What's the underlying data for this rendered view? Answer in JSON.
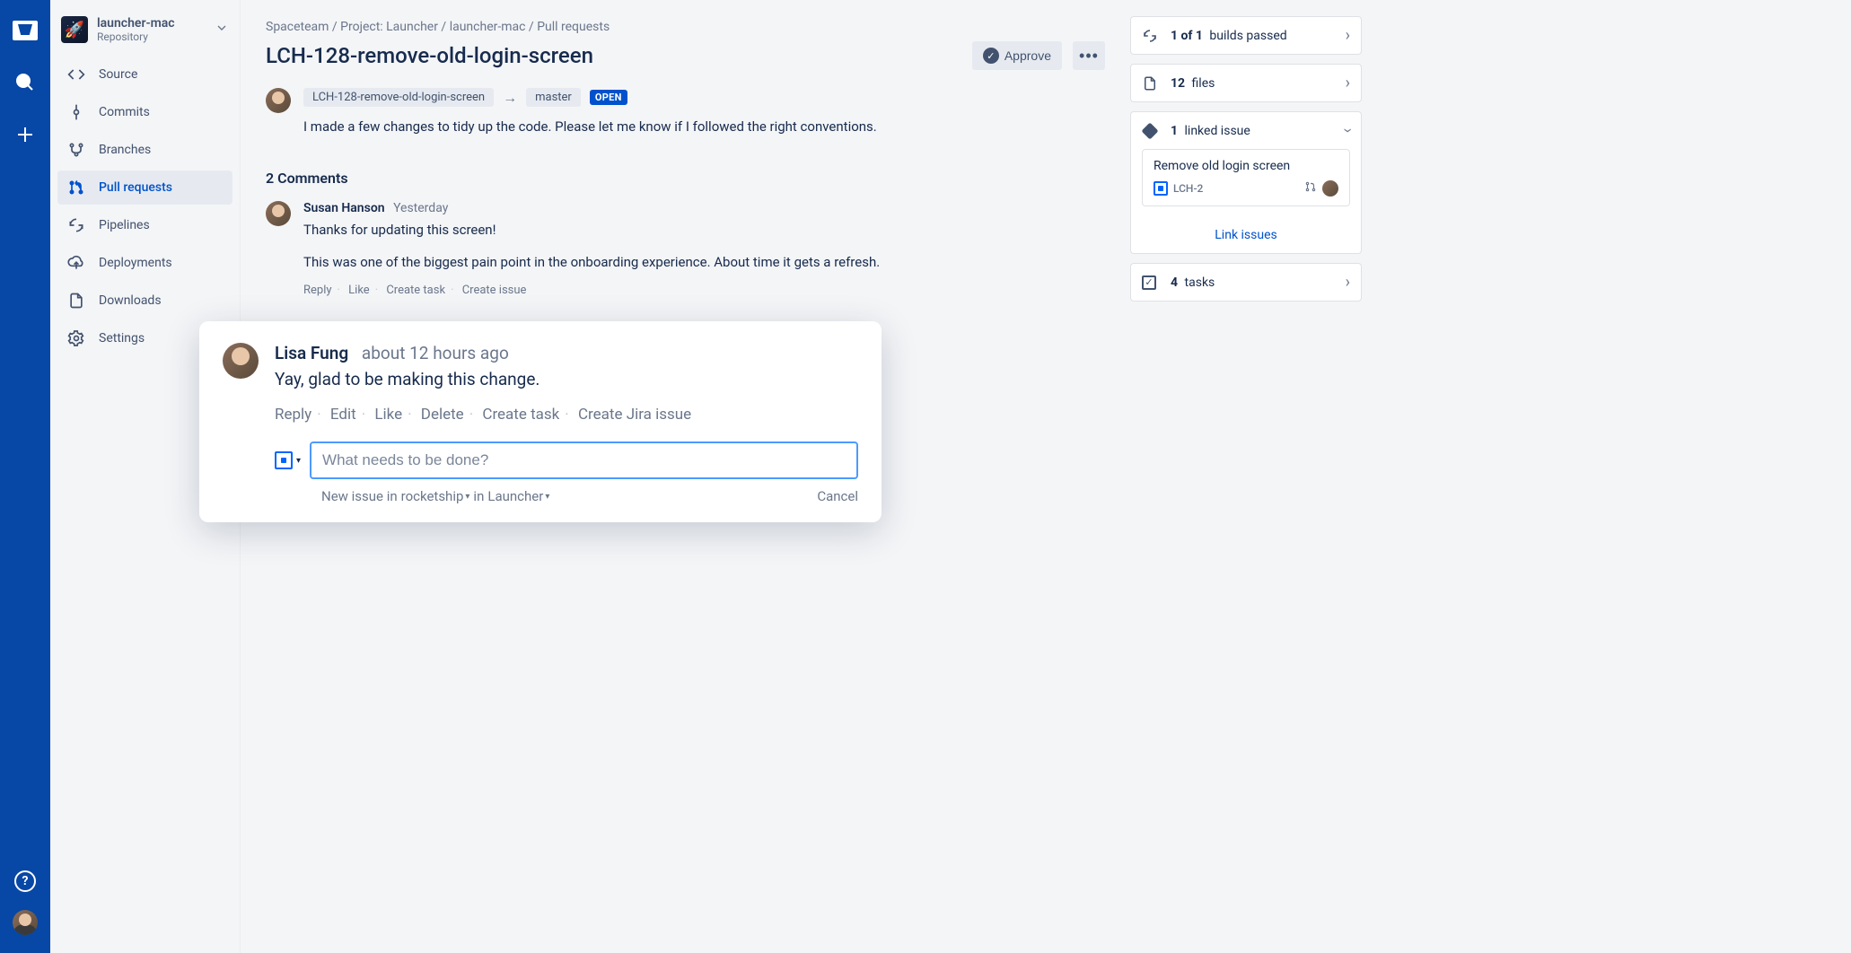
{
  "project": {
    "name": "launcher-mac",
    "type": "Repository"
  },
  "nav": {
    "items": [
      {
        "label": "Source"
      },
      {
        "label": "Commits"
      },
      {
        "label": "Branches"
      },
      {
        "label": "Pull requests"
      },
      {
        "label": "Pipelines"
      },
      {
        "label": "Deployments"
      },
      {
        "label": "Downloads"
      },
      {
        "label": "Settings"
      }
    ]
  },
  "breadcrumb": {
    "a": "Spaceteam",
    "b": "Project: Launcher",
    "c": "launcher-mac",
    "d": "Pull requests"
  },
  "pr": {
    "title": "LCH-128-remove-old-login-screen",
    "approve": "Approve",
    "source_branch": "LCH-128-remove-old-login-screen",
    "target_branch": "master",
    "status": "OPEN",
    "desc": "I made a few changes to tidy up the code. Please let me know if I followed the right conventions."
  },
  "comments": {
    "heading": "2 Comments",
    "c1": {
      "author": "Susan Hanson",
      "time": "Yesterday",
      "text1": "Thanks for updating this screen!",
      "text2": "This was one of the biggest pain point in the onboarding experience. About time it gets a refresh.",
      "actions": {
        "reply": "Reply",
        "like": "Like",
        "task": "Create task",
        "issue": "Create issue"
      }
    }
  },
  "popup": {
    "author": "Lisa Fung",
    "time": "about 12 hours ago",
    "text": "Yay, glad to be making this change.",
    "actions": {
      "reply": "Reply",
      "edit": "Edit",
      "like": "Like",
      "delete": "Delete",
      "task": "Create task",
      "jira": "Create Jira issue"
    },
    "input_placeholder": "What needs to be done?",
    "meta_prefix": "New issue in ",
    "meta_project": "rocketship",
    "meta_in": " in ",
    "meta_space": "Launcher",
    "cancel": "Cancel"
  },
  "right": {
    "builds_a": "1 of 1",
    "builds_b": " builds passed",
    "files_a": "12",
    "files_b": " files",
    "linked_a": "1",
    "linked_b": " linked issue",
    "linked_title": "Remove old login screen",
    "linked_key": "LCH-2",
    "link_btn": "Link issues",
    "tasks_a": "4",
    "tasks_b": " tasks"
  }
}
